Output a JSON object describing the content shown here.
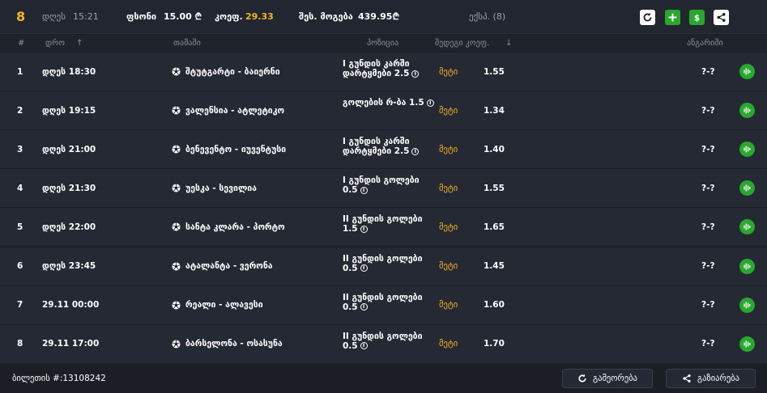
{
  "topbar": {
    "brand_icon": "8",
    "date_label": "დღეს",
    "time": "15:21",
    "stake_label": "ფსონი",
    "stake_value": "15.00 ₾",
    "coef_label": "კოეფ.",
    "coef_value": "29.33",
    "win_label": "შეს. მოგება",
    "win_value": "439.95₾",
    "express_label": "ექსპ. (8)",
    "buttons": [
      "refresh-icon",
      "plus-icon",
      "dollar-icon",
      "share-icon"
    ],
    "colors": {
      "accent": "#f3b51c",
      "green": "#29a72e"
    }
  },
  "table": {
    "headers": {
      "num": "#",
      "time": "დრო",
      "sort_up": "↑",
      "game": "თამაში",
      "position": "პოზიცია",
      "coef": "შედეგი კოეფ.",
      "sort_down": "↓",
      "score": "ანგარიში"
    },
    "rows": [
      {
        "num": "1",
        "time": "დღეს  18:30",
        "game": "შტუტგარტი - ბაიერნი",
        "pos": "I გუნდის კარში დარტყმები 2.5",
        "pick": "მეტი",
        "coef": "1.55",
        "score": "?-?"
      },
      {
        "num": "2",
        "time": "დღეს  19:15",
        "game": "ვალენსია - ატლეტიკო",
        "pos": "გოლების რ-ბა 1.5",
        "pick": "მეტი",
        "coef": "1.34",
        "score": "?-?"
      },
      {
        "num": "3",
        "time": "დღეს  21:00",
        "game": "ბენევენტო - იუვენტუსი",
        "pos": "I გუნდის კარში დარტყმები 2.5",
        "pick": "მეტი",
        "coef": "1.40",
        "score": "?-?"
      },
      {
        "num": "4",
        "time": "დღეს  21:30",
        "game": "უესკა - სევილია",
        "pos": "I გუნდის გოლები 0.5",
        "pick": "მეტი",
        "coef": "1.55",
        "score": "?-?"
      },
      {
        "num": "5",
        "time": "დღეს  22:00",
        "game": "სანტა კლარა - პორტო",
        "pos": "II გუნდის გოლები 1.5",
        "pick": "მეტი",
        "coef": "1.65",
        "score": "?-?"
      },
      {
        "num": "6",
        "time": "დღეს  23:45",
        "game": "ატალანტა - ვერონა",
        "pos": "II გუნდის გოლები 0.5",
        "pick": "მეტი",
        "coef": "1.45",
        "score": "?-?"
      },
      {
        "num": "7",
        "time": "29.11  00:00",
        "game": "რეალი - ალავესი",
        "pos": "II გუნდის გოლები 0.5",
        "pick": "მეტი",
        "coef": "1.60",
        "score": "?-?"
      },
      {
        "num": "8",
        "time": "29.11  17:00",
        "game": "ბარსელონა - ოსასუნა",
        "pos": "II გუნდის გოლები 0.5",
        "pick": "მეტი",
        "coef": "1.70",
        "score": "?-?"
      }
    ],
    "info_icon": "i"
  },
  "footer": {
    "ticket": "ბილეთის #:13108242",
    "repeat_label": "გამეორება",
    "share_label": "გაზიარება"
  }
}
